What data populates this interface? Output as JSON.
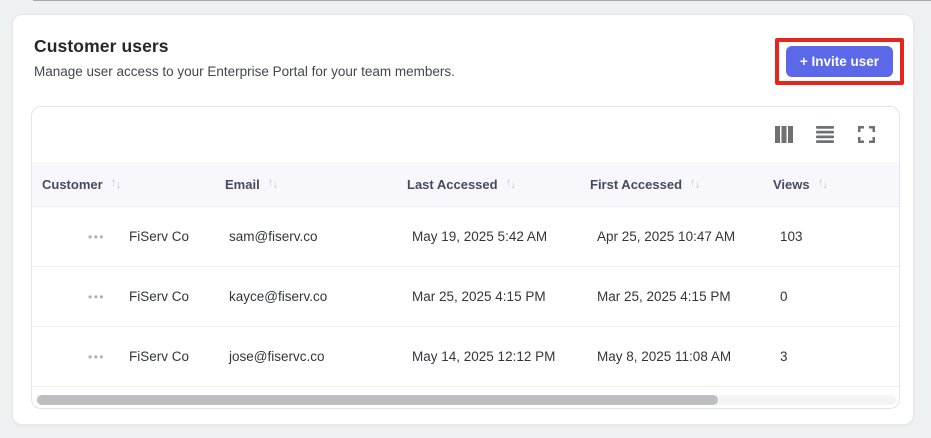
{
  "card": {
    "title": "Customer users",
    "subtitle": "Manage user access to your Enterprise Portal for your team members."
  },
  "invite_button": {
    "label": "+ Invite user",
    "background": "#5b68e8",
    "annotation_color": "#e8251a"
  },
  "toolbar": {
    "icons": [
      "columns-icon",
      "row-density-icon",
      "fullscreen-icon"
    ],
    "icon_color": "#6e7174"
  },
  "table": {
    "sort_asc_glyph": "↑",
    "sort_desc_glyph": "↓",
    "row_menu_glyph": "•••",
    "header_bg": "#f8f8fc",
    "columns": [
      {
        "label": "Customer"
      },
      {
        "label": "Email"
      },
      {
        "label": "Last Accessed"
      },
      {
        "label": "First Accessed"
      },
      {
        "label": "Views"
      }
    ],
    "rows": [
      {
        "customer": "FiServ Co",
        "email": "sam@fiserv.co",
        "last_accessed": "May 19, 2025 5:42 AM",
        "first_accessed": "Apr 25, 2025 10:47 AM",
        "views": "103"
      },
      {
        "customer": "FiServ Co",
        "email": "kayce@fiserv.co",
        "last_accessed": "Mar 25, 2025 4:15 PM",
        "first_accessed": "Mar 25, 2025 4:15 PM",
        "views": "0"
      },
      {
        "customer": "FiServ Co",
        "email": "jose@fiservc.co",
        "last_accessed": "May 14, 2025 12:12 PM",
        "first_accessed": "May 8, 2025 11:08 AM",
        "views": "3"
      }
    ]
  },
  "scrollbar": {
    "thumb_color": "#bcbec2"
  }
}
